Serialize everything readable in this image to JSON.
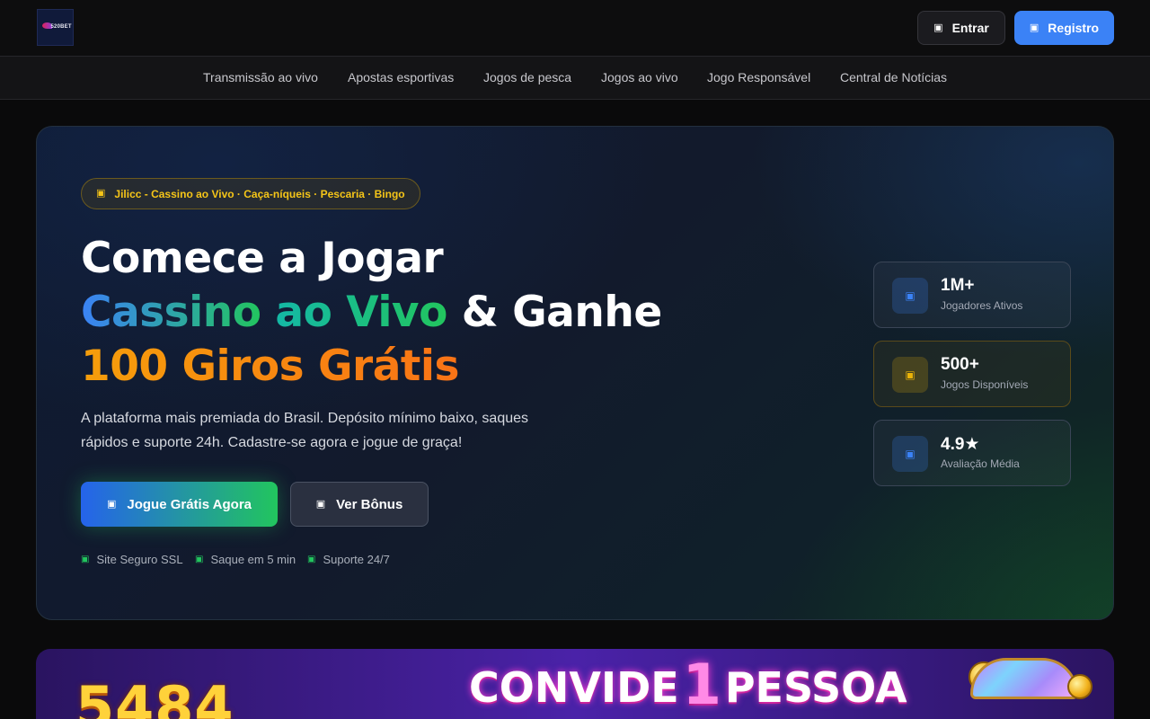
{
  "brand": {
    "logo_text": "520BET"
  },
  "header": {
    "login_label": "Entrar",
    "register_label": "Registro",
    "login_icon": "sign-in-icon",
    "register_icon": "user-plus-icon"
  },
  "nav": {
    "items": [
      {
        "label": "Transmissão ao vivo"
      },
      {
        "label": "Apostas esportivas"
      },
      {
        "label": "Jogos de pesca"
      },
      {
        "label": "Jogos ao vivo"
      },
      {
        "label": "Jogo Responsável"
      },
      {
        "label": "Central de Notícias"
      }
    ]
  },
  "hero": {
    "badge": "Jilicc - Cassino ao Vivo · Caça-níqueis · Pescaria · Bingo",
    "title_line1": "Comece a Jogar",
    "title_line2_highlight_a": "Cassino",
    "title_line2_highlight_b": "ao Vivo",
    "title_line2_rest": "& Ganhe",
    "title_line3": "100 Giros Grátis",
    "description": "A plataforma mais premiada do Brasil. Depósito mínimo baixo, saques rápidos e suporte 24h. Cadastre-se agora e jogue de graça!",
    "cta_primary": "Jogue Grátis Agora",
    "cta_secondary": "Ver Bônus",
    "trust": [
      {
        "label": "Site Seguro SSL"
      },
      {
        "label": "Saque em 5 min"
      },
      {
        "label": "Suporte 24/7"
      }
    ],
    "stats": [
      {
        "value": "1M+",
        "label": "Jogadores Ativos",
        "icon": "users-icon"
      },
      {
        "value": "500+",
        "label": "Jogos Disponíveis",
        "icon": "gamepad-icon"
      },
      {
        "value": "4.9★",
        "label": "Avaliação Média",
        "icon": "star-icon"
      }
    ]
  },
  "banner": {
    "left_number": "5484",
    "title_a": "CONVIDE",
    "title_num": "1",
    "title_b": "PESSOA"
  },
  "colors": {
    "accent_blue": "#3b82f6",
    "accent_green": "#22c55e",
    "accent_orange": "#f59e0b",
    "badge_gold": "#f5c518"
  }
}
